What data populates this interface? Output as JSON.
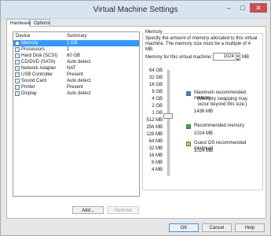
{
  "window": {
    "title": "Virtual Machine Settings",
    "controls": {
      "minimize": "–",
      "maximize": "□",
      "close": "✕"
    }
  },
  "tabs": [
    {
      "label": "Hardware",
      "active": true
    },
    {
      "label": "Options",
      "active": false
    }
  ],
  "device_list": {
    "headers": {
      "device": "Device",
      "summary": "Summary"
    },
    "rows": [
      {
        "device": "Memory",
        "summary": "1 GB",
        "icon": "memory-icon",
        "selected": true
      },
      {
        "device": "Processors",
        "summary": "1",
        "icon": "processor-icon"
      },
      {
        "device": "Hard Disk (SCSI)",
        "summary": "60 GB",
        "icon": "hard-disk-icon"
      },
      {
        "device": "CD/DVD (SATA)",
        "summary": "Auto detect",
        "icon": "cd-dvd-icon"
      },
      {
        "device": "Network Adapter",
        "summary": "NAT",
        "icon": "network-adapter-icon"
      },
      {
        "device": "USB Controller",
        "summary": "Present",
        "icon": "usb-controller-icon"
      },
      {
        "device": "Sound Card",
        "summary": "Auto detect",
        "icon": "sound-card-icon"
      },
      {
        "device": "Printer",
        "summary": "Present",
        "icon": "printer-icon"
      },
      {
        "device": "Display",
        "summary": "Auto detect",
        "icon": "display-icon"
      }
    ]
  },
  "buttons": {
    "add": "Add...",
    "remove": "Remove"
  },
  "memory": {
    "group_title": "Memory",
    "description": "Specify the amount of memory allocated to this virtual machine. The memory size must be a multiple of 4 MB.",
    "field_label": "Memory for this virtual machine:",
    "value": "1024",
    "unit": "MB",
    "ticks": [
      "64 GB",
      "32 GB",
      "16 GB",
      "8 GB",
      "4 GB",
      "2 GB",
      "1 GB",
      "512 MB",
      "256 MB",
      "128 MB",
      "64 MB",
      "32 MB",
      "16 MB",
      "8 MB",
      "4 MB"
    ],
    "slider_value_mb": 1024,
    "markers": [
      {
        "label": "Maximum recommended memory",
        "note": "(Memory swapping may occur beyond this size.)",
        "value": "1436 MB",
        "color": "#3a7fd5"
      },
      {
        "label": "Recommended memory",
        "value": "1024 MB",
        "color": "#3fa83f"
      },
      {
        "label": "Guest OS recommended minimum",
        "value": "1024 MB",
        "color": "#d9c63a"
      }
    ]
  },
  "footer": {
    "ok": "OK",
    "cancel": "Cancel",
    "help": "Help"
  }
}
